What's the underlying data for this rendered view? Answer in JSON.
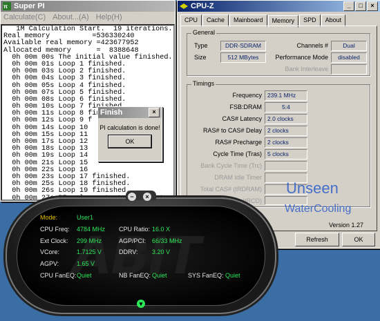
{
  "superpi": {
    "title": "Super PI",
    "menu": [
      "Calculate(C)",
      "About...(A)",
      "Help(H)"
    ],
    "lines": [
      "   1M Calculation Start.  19 iterations.",
      "Real memory          =536330240",
      "Available real memory =423677952",
      "Allocated memory      =  8388648",
      "  0h 00m 00s The initial value finished.",
      "  0h 00m 01s Loop 1 finished.",
      "  0h 00m 03s Loop 2 finished.",
      "  0h 00m 04s Loop 3 finished.",
      "  0h 00m 05s Loop 4 finished.",
      "  0h 00m 07s Loop 5 finished.",
      "  0h 00m 08s Loop 6 finished.",
      "  0h 00m 10s Loop 7 finished.",
      "  0h 00m 11s Loop 8 finished.",
      "  0h 00m 12s Loop 9 f",
      "  0h 00m 14s Loop 10",
      "  0h 00m 15s Loop 11",
      "  0h 00m 17s Loop 12",
      "  0h 00m 18s Loop 13",
      "  0h 00m 19s Loop 14",
      "  0h 00m 21s Loop 15",
      "  0h 00m 22s Loop 16",
      "  0h 00m 23s Loop 17 finished.",
      "  0h 00m 25s Loop 18 finished.",
      "  0h 00m 26s Loop 19 finished.",
      "  0h 00m 27s PI value output -> pi_data."
    ]
  },
  "finish": {
    "title": "Finish",
    "message": "PI calculation is done!",
    "ok": "OK"
  },
  "cpuz": {
    "title": "CPU-Z",
    "tabs": [
      "CPU",
      "Cache",
      "Mainboard",
      "Memory",
      "SPD",
      "About"
    ],
    "general": {
      "label": "General",
      "type_label": "Type",
      "type": "DDR-SDRAM",
      "size_label": "Size",
      "size": "512 MBytes",
      "channels_label": "Channels #",
      "channels": "Dual",
      "perf_label": "Performance Mode",
      "perf": "disabled",
      "bank_label": "Bank Interleave"
    },
    "timings": {
      "label": "Timings",
      "freq_label": "Frequency",
      "freq": "239.1 MHz",
      "fsb_label": "FSB:DRAM",
      "fsb": "5:4",
      "cas_label": "CAS# Latency",
      "cas": "2.0 clocks",
      "rcd_label": "RAS# to CAS# Delay",
      "rcd": "2 clocks",
      "rp_label": "RAS# Precharge",
      "rp": "2 clocks",
      "tras_label": "Cycle Time (Tras)",
      "tras": "5 clocks",
      "trc_label": "Bank Cycle Time (Trc)",
      "idle_label": "DRAM Idle Timer",
      "total_cas_label": "Total CAS# (tRDRAM)",
      "rtc_label": "to Column (tRCD)"
    },
    "version": "Version 1.27",
    "refresh": "Refresh",
    "ok": "OK",
    "watermark1": "Unseen",
    "watermark2": "WaterCooling"
  },
  "uguru": {
    "mode_label": "Mode:",
    "mode": "User1",
    "cpu_freq_label": "CPU Freq:",
    "cpu_freq": "4784 MHz",
    "cpu_ratio_label": "CPU Ratio:",
    "cpu_ratio": "16.0 X",
    "ext_clock_label": "Ext Clock:",
    "ext_clock": "299 MHz",
    "agp_pci_label": "AGP/PCI:",
    "agp_pci": "66/33 MHz",
    "vcore_label": "VCore:",
    "vcore": "1.7125 V",
    "ddrv_label": "DDRV:",
    "ddrv": "3.20 V",
    "agpv_label": "AGPV:",
    "agpv": "1.65 V",
    "cpu_faneq_label": "CPU FanEQ:",
    "cpu_faneq": "Quiet",
    "nb_faneq_label": "NB FanEQ:",
    "nb_faneq": "Quiet",
    "sys_faneq_label": "SYS FanEQ:",
    "sys_faneq": "Quiet"
  }
}
